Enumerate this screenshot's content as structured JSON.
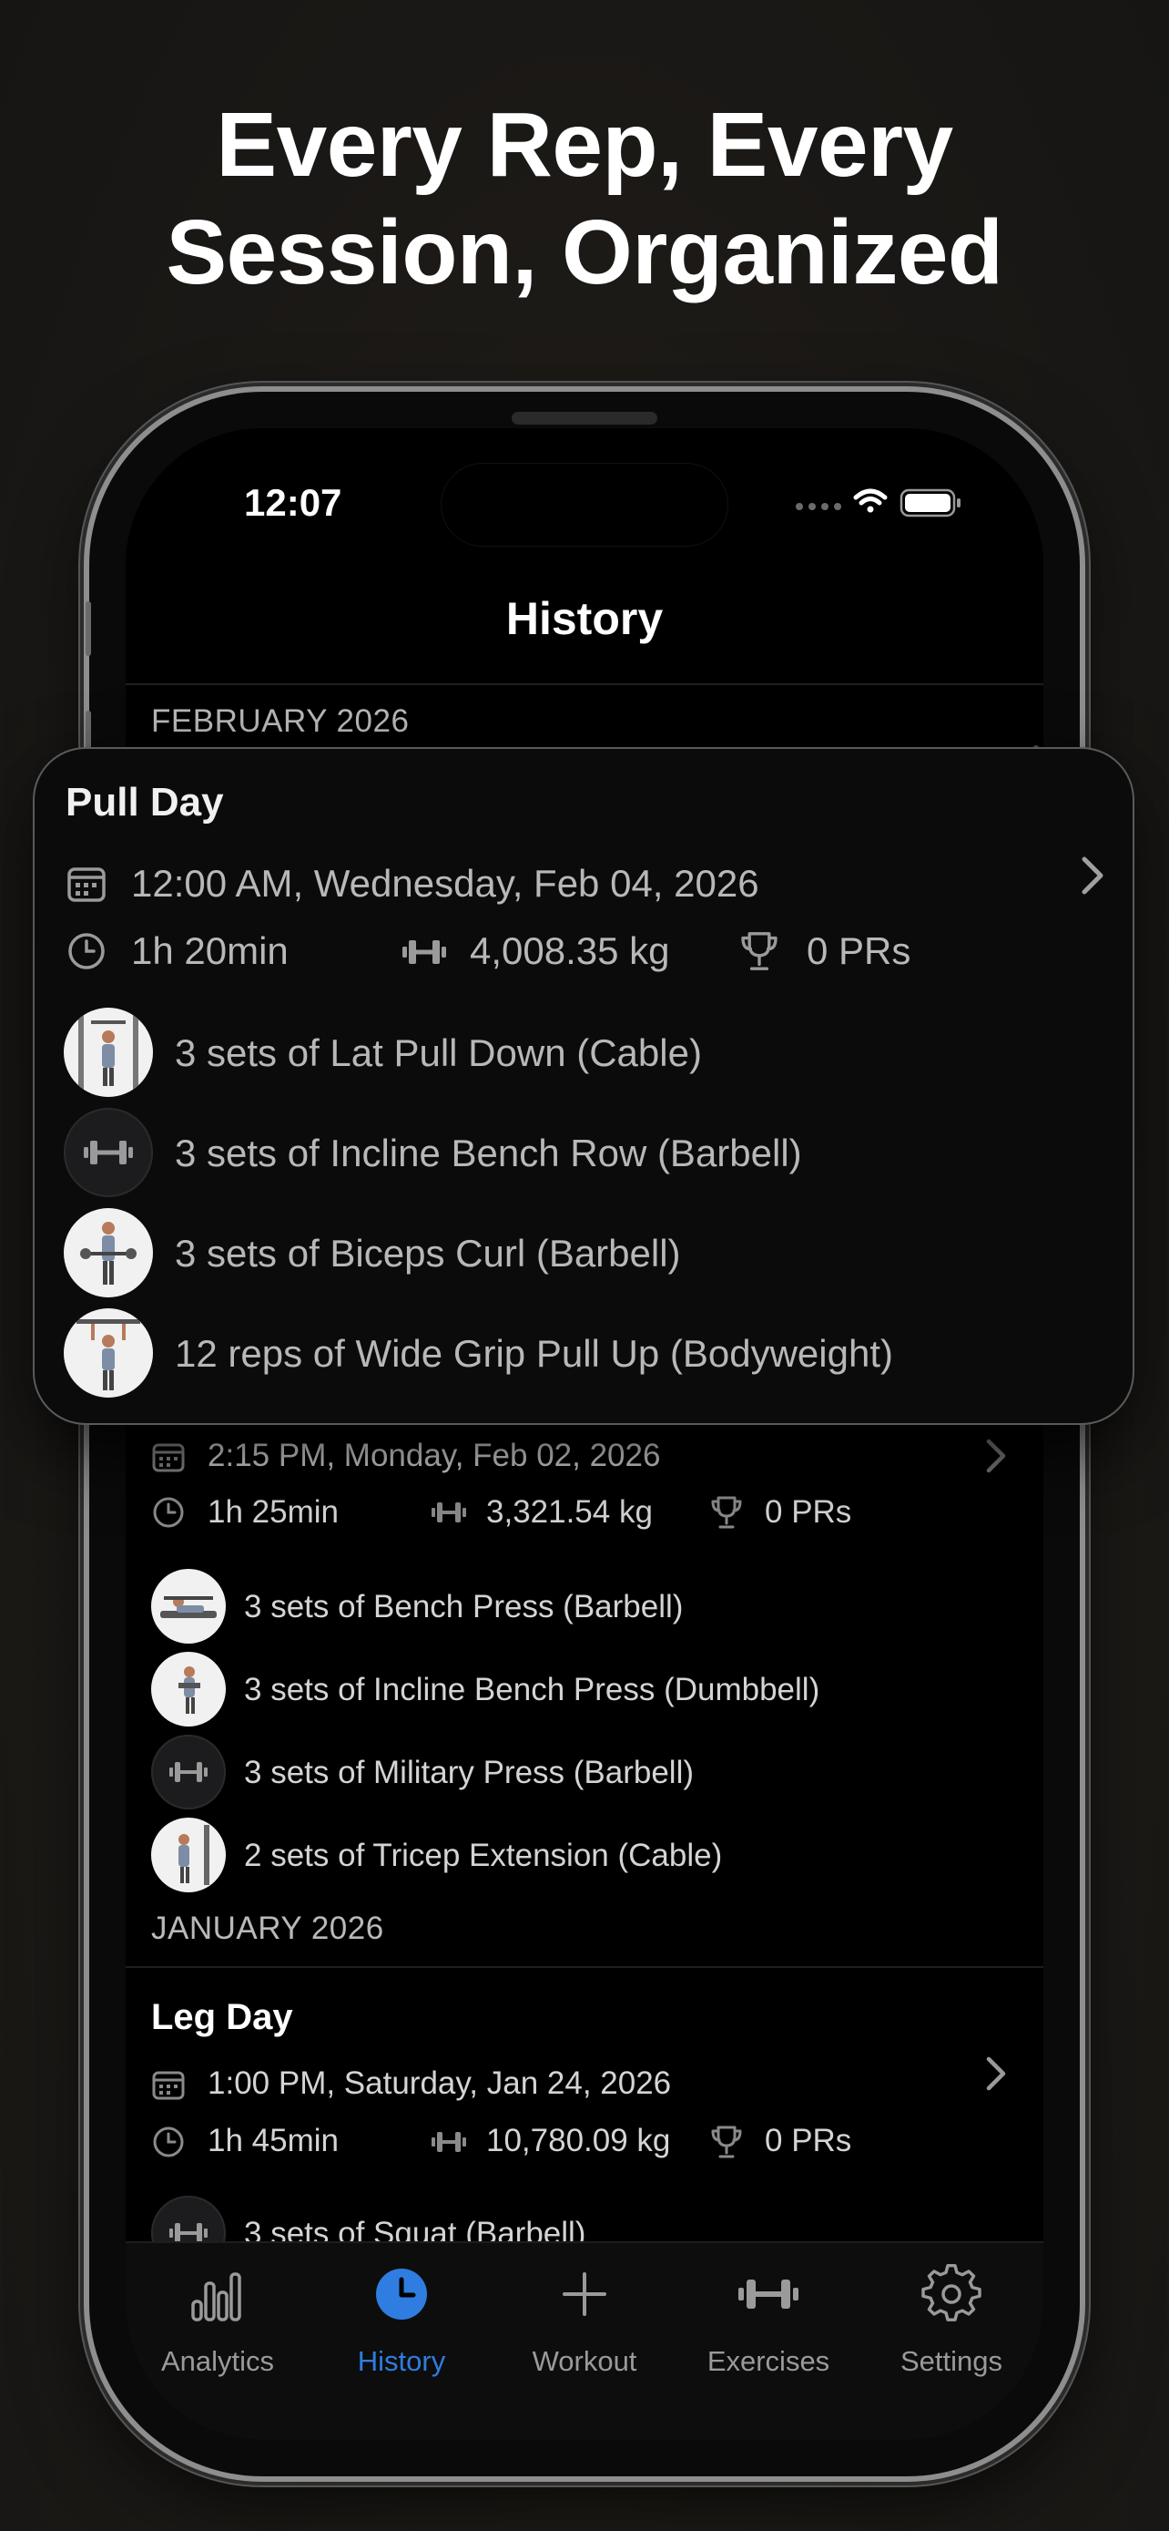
{
  "headline": {
    "line1": "Every Rep, Every",
    "line2": "Session, Organized"
  },
  "status_bar": {
    "time": "12:07"
  },
  "nav": {
    "title": "History"
  },
  "sections": {
    "feb": "FEBRUARY 2026",
    "jan": "JANUARY 2026"
  },
  "featured": {
    "title": "Pull Day",
    "datetime": "12:00 AM, Wednesday, Feb 04, 2026",
    "duration": "1h 20min",
    "volume": "4,008.35 kg",
    "prs": "0 PRs",
    "exercises": [
      {
        "text": "3 sets of Lat Pull Down (Cable)",
        "icon": "exercise-photo"
      },
      {
        "text": "3 sets of Incline Bench Row (Barbell)",
        "icon": "dumbbell-icon"
      },
      {
        "text": "3 sets of Biceps Curl (Barbell)",
        "icon": "exercise-photo"
      },
      {
        "text": "12 reps of Wide Grip Pull Up (Bodyweight)",
        "icon": "exercise-photo"
      }
    ]
  },
  "push": {
    "datetime": "2:15 PM, Monday, Feb 02, 2026",
    "duration": "1h 25min",
    "volume": "3,321.54 kg",
    "prs": "0 PRs",
    "exercises": [
      {
        "text": "3 sets of Bench Press (Barbell)",
        "icon": "exercise-photo"
      },
      {
        "text": "3 sets of Incline Bench Press (Dumbbell)",
        "icon": "exercise-photo"
      },
      {
        "text": "3 sets of Military Press (Barbell)",
        "icon": "dumbbell-icon"
      },
      {
        "text": "2 sets of Tricep Extension (Cable)",
        "icon": "exercise-photo"
      }
    ]
  },
  "leg": {
    "title": "Leg Day",
    "datetime": "1:00 PM, Saturday, Jan 24, 2026",
    "duration": "1h 45min",
    "volume": "10,780.09 kg",
    "prs": "0 PRs",
    "exercises": [
      {
        "text": "3 sets of Squat (Barbell)",
        "icon": "dumbbell-icon"
      }
    ]
  },
  "tabs": [
    {
      "label": "Analytics",
      "icon": "bar-chart-icon"
    },
    {
      "label": "History",
      "icon": "clock-icon",
      "active": true
    },
    {
      "label": "Workout",
      "icon": "plus-icon"
    },
    {
      "label": "Exercises",
      "icon": "dumbbell-icon"
    },
    {
      "label": "Settings",
      "icon": "gear-icon"
    }
  ],
  "colors": {
    "accent": "#2f7de0",
    "background": "#000000",
    "card": "#0b0b0b"
  }
}
